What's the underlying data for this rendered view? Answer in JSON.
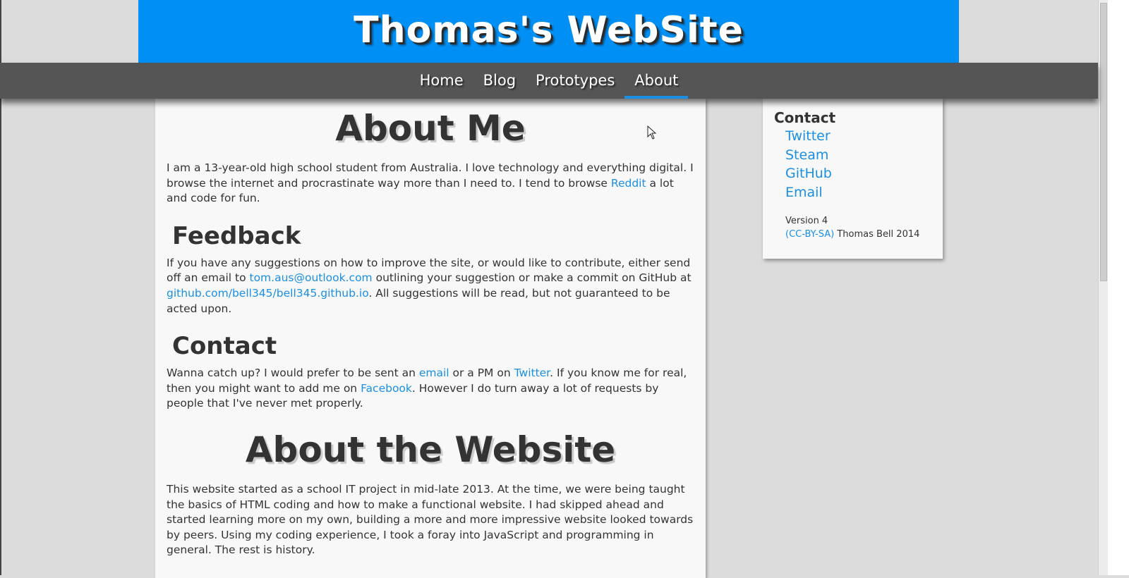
{
  "header": {
    "title": "Thomas's WebSite"
  },
  "nav": {
    "items": [
      "Home",
      "Blog",
      "Prototypes",
      "About"
    ],
    "active": "About"
  },
  "main": {
    "about_me": {
      "heading": "About Me",
      "text1": "I am a 13-year-old high school student from Australia. I love technology and everything digital. I browse the internet and procrastinate way more than I need to. I tend to browse ",
      "link_reddit": "Reddit",
      "text2": " a lot and code for fun."
    },
    "feedback": {
      "heading": "Feedback",
      "text1": "If you have any suggestions on how to improve the site, or would like to contribute, either send off an email to ",
      "link_email": "tom.aus@outlook.com",
      "text2": " outlining your suggestion or make a commit on GitHub at ",
      "link_github": "github.com/bell345/bell345.github.io",
      "text3": ". All suggestions will be read, but not guaranteed to be acted upon."
    },
    "contact": {
      "heading": "Contact",
      "text1": "Wanna catch up? I would prefer to be sent an ",
      "link_email": "email",
      "text2": " or a PM on ",
      "link_twitter": "Twitter",
      "text3": ". If you know me for real, then you might want to add me on ",
      "link_facebook": "Facebook",
      "text4": ". However I do turn away a lot of requests by people that I've never met properly."
    },
    "about_website": {
      "heading": "About the Website",
      "text": "This website started as a school IT project in mid-late 2013. At the time, we were being taught the basics of HTML coding and how to make a functional website. I had skipped ahead and started learning more on my own, building a more and more impressive website looked towards by peers. Using my coding experience, I took a foray into JavaScript and programming in general. The rest is history."
    }
  },
  "sidebar": {
    "title": "Contact",
    "links": [
      "Twitter",
      "Steam",
      "GitHub",
      "Email"
    ],
    "version": "Version 4",
    "license_link": "(CC-BY-SA)",
    "copyright": " Thomas Bell 2014"
  },
  "colors": {
    "header_bg": "#0090f5",
    "nav_bg": "#555555",
    "link": "#1a8fe3",
    "page_bg": "#dcdcdc"
  },
  "icons": {
    "cursor": "mouse-pointer-icon"
  }
}
